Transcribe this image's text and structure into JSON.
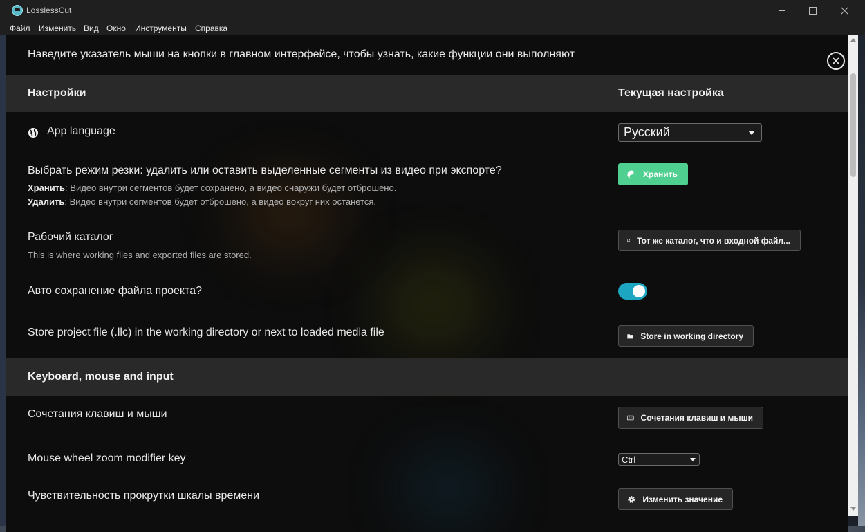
{
  "window": {
    "title": "LosslessCut"
  },
  "menu": [
    "Файл",
    "Изменить",
    "Вид",
    "Окно",
    "Инструменты",
    "Справка"
  ],
  "hint": "Наведите указатель мыши на кнопки в главном интерфейсе, чтобы узнать, какие функции они выполняют",
  "header": {
    "settings": "Настройки",
    "current": "Текущая настройка"
  },
  "rows": {
    "language": {
      "label": "App language",
      "value": "Русский"
    },
    "cut_mode": {
      "label": "Выбрать режим резки: удалить или оставить выделенные сегменты из видео при экспорте?",
      "keep_term": "Хранить",
      "keep_desc": ": Видео внутри сегментов будет сохранено, а видео снаружи будет отброшено.",
      "delete_term": "Удалить",
      "delete_desc": ": Видео внутри сегментов будет отброшено, а видео вокруг них останется.",
      "button": "Хранить"
    },
    "working_dir": {
      "label": "Рабочий каталог",
      "desc": "This is where working files and exported files are stored.",
      "button": "Тот же каталог, что и входной файл..."
    },
    "autosave": {
      "label": "Авто сохранение файла проекта?",
      "enabled": true
    },
    "store_project": {
      "label": "Store project file (.llc) in the working directory or next to loaded media file",
      "button": "Store in working directory"
    }
  },
  "section_keyboard": {
    "title": "Keyboard, mouse and input"
  },
  "rows2": {
    "shortcuts": {
      "label": "Сочетания клавиш и мыши",
      "button": "Сочетания клавиш и мыши"
    },
    "zoom_modifier": {
      "label": "Mouse wheel zoom modifier key",
      "value": "Ctrl"
    },
    "scroll_sensitivity": {
      "label": "Чувствительность прокрутки шкалы времени",
      "button": "Изменить значение"
    }
  },
  "colors": {
    "accent_green": "#4fcf90",
    "toggle_on": "#1da6c2",
    "panel_bg": "#0d0d0d",
    "section_bg": "#292929"
  }
}
